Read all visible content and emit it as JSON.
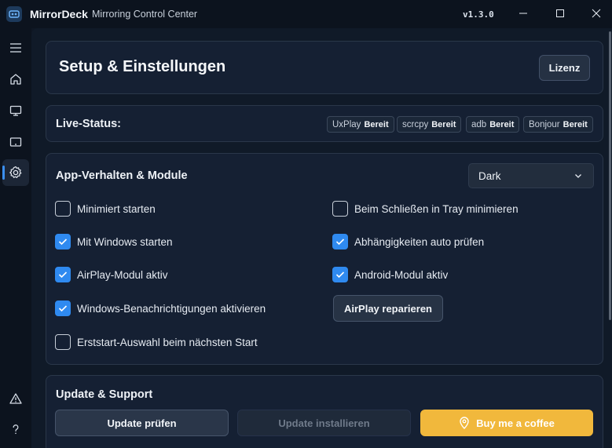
{
  "titlebar": {
    "app_name": "MirrorDeck",
    "subtitle": "Mirroring Control Center",
    "version": "v1.3.0"
  },
  "sidebar": {
    "items": [
      {
        "icon": "hamburger-menu-icon"
      },
      {
        "icon": "home-icon"
      },
      {
        "icon": "monitor-icon"
      },
      {
        "icon": "tablet-icon"
      },
      {
        "icon": "gear-icon",
        "active": true
      },
      {
        "icon": "warning-icon"
      },
      {
        "icon": "help-icon"
      }
    ]
  },
  "header": {
    "title": "Setup & Einstellungen",
    "license_label": "Lizenz"
  },
  "status": {
    "label": "Live-Status:",
    "chips": [
      {
        "name": "UxPlay",
        "state": "Bereit"
      },
      {
        "name": "scrcpy",
        "state": "Bereit"
      },
      {
        "name": "adb",
        "state": "Bereit"
      },
      {
        "name": "Bonjour",
        "state": "Bereit"
      }
    ]
  },
  "app": {
    "title": "App-Verhalten & Module",
    "theme_selected": "Dark",
    "options": [
      {
        "label": "Minimiert starten",
        "checked": false
      },
      {
        "label": "Beim Schließen in Tray minimieren",
        "checked": false
      },
      {
        "label": "Mit Windows starten",
        "checked": true
      },
      {
        "label": "Abhängigkeiten auto prüfen",
        "checked": true
      },
      {
        "label": "AirPlay-Modul aktiv",
        "checked": true
      },
      {
        "label": "Android-Modul aktiv",
        "checked": true
      },
      {
        "label": "Windows-Benachrichtigungen aktivieren",
        "checked": true
      },
      {
        "label": "Erststart-Auswahl beim nächsten Start",
        "checked": false
      }
    ],
    "repair_label": "AirPlay reparieren"
  },
  "update": {
    "title": "Update & Support",
    "check_label": "Update prüfen",
    "install_label": "Update installieren",
    "coffee_label": "Buy me a coffee"
  },
  "colors": {
    "accent": "#2f8af0",
    "coffee": "#f1b83c"
  }
}
